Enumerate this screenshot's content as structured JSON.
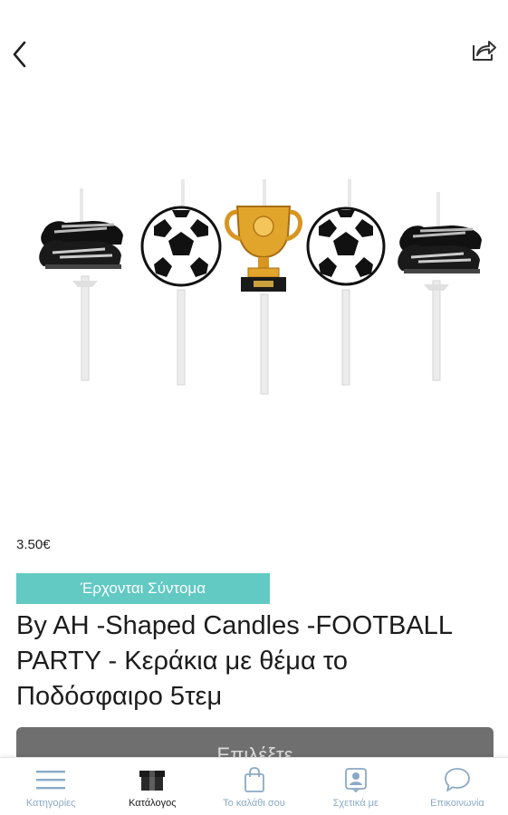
{
  "header": {
    "back_icon": "chevron-left-icon",
    "share_icon": "share-icon"
  },
  "product": {
    "image_description_icons": [
      "football-boot-icon",
      "soccer-ball-icon",
      "trophy-icon",
      "soccer-ball-icon",
      "football-boot-icon"
    ],
    "price": "3.50€",
    "badge": "Έρχονται Σύντομα",
    "title": "By AH -Shaped Candles -FOOTBALL PARTY - Κεράκια με θέμα το Ποδόσφαιρο 5τεμ",
    "select_label": "Επιλέξτε"
  },
  "tabbar": {
    "items": [
      {
        "label": "Κατηγορίες",
        "icon": "menu-lines-icon",
        "active": false
      },
      {
        "label": "Κατάλογος",
        "icon": "box-icon",
        "active": true
      },
      {
        "label": "Το καλάθι σου",
        "icon": "shopping-bag-icon",
        "active": false
      },
      {
        "label": "Σχετικά με",
        "icon": "contact-badge-icon",
        "active": false
      },
      {
        "label": "Επικοινωνία",
        "icon": "chat-bubble-icon",
        "active": false
      }
    ]
  },
  "colors": {
    "badge_bg": "#62c9c3",
    "button_bg": "#6f6f6f",
    "tab_inactive": "#8aa9c6",
    "tab_active": "#1a1a1a"
  }
}
